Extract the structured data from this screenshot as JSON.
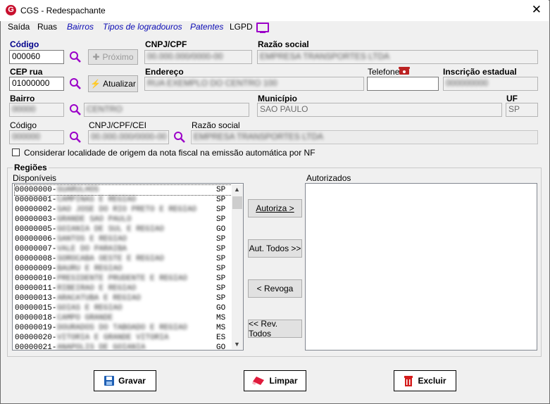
{
  "window": {
    "title": "CGS - Redespachante"
  },
  "menu": [
    "Saída",
    "Ruas",
    "Bairros",
    "Tipos de logradouros",
    "Patentes",
    "LGPD"
  ],
  "form": {
    "codigo_label": "Código",
    "codigo_value": "000060",
    "proximo_label": "Próximo",
    "cnpj_label": "CNPJ/CPF",
    "cnpj_value": "00.000.000/0000-00",
    "razao_label": "Razão social",
    "razao_value": "EMPRESA TRANSPORTES LTDA",
    "cep_label": "CEP rua",
    "cep_value": "01000000",
    "atualizar_label": "Atualizar",
    "endereco_label": "Endereço",
    "endereco_value": "RUA EXEMPLO DO CENTRO 100",
    "telefone_label": "Telefone",
    "telefone_value": "",
    "ie_label": "Inscrição estadual",
    "ie_value": "000000000",
    "bairro_label": "Bairro",
    "bairro_value": "00000",
    "bairro_desc": "CENTRO",
    "municipio_label": "Município",
    "municipio_value": "SAO PAULO",
    "uf_label": "UF",
    "uf_value": "SP",
    "codigo2_label": "Código",
    "codigo2_value": "000000",
    "cnpj2_label": "CNPJ/CPF/CEI",
    "cnpj2_value": "00.000.000/0000-00",
    "razao2_label": "Razão social",
    "razao2_value": "EMPRESA TRANSPORTES LTDA",
    "considerar_label": "Considerar localidade de origem da nota fiscal na emissão automática por NF"
  },
  "regioes": {
    "title": "Regiões",
    "disponiveis_label": "Disponíveis",
    "autorizados_label": "Autorizados",
    "items": [
      {
        "code": "00000000-",
        "name": "GUARULHOS",
        "uf": "SP"
      },
      {
        "code": "00000001-",
        "name": "CAMPINAS E REGIAO",
        "uf": "SP"
      },
      {
        "code": "00000002-",
        "name": "SAO JOSE DO RIO PRETO E REGIAO",
        "uf": "SP"
      },
      {
        "code": "00000003-",
        "name": "GRANDE SAO PAULO",
        "uf": "SP"
      },
      {
        "code": "00000005-",
        "name": "GOIANIA DE SUL E REGIAO",
        "uf": "GO"
      },
      {
        "code": "00000006-",
        "name": "SANTOS E REGIAO",
        "uf": "SP"
      },
      {
        "code": "00000007-",
        "name": "VALE DO PARAIBA",
        "uf": "SP"
      },
      {
        "code": "00000008-",
        "name": "SOROCABA OESTE E REGIAO",
        "uf": "SP"
      },
      {
        "code": "00000009-",
        "name": "BAURU E REGIAO",
        "uf": "SP"
      },
      {
        "code": "00000010-",
        "name": "PRESIDENTE PRUDENTE E REGIAO",
        "uf": "SP"
      },
      {
        "code": "00000011-",
        "name": "RIBEIRAO E REGIAO",
        "uf": "SP"
      },
      {
        "code": "00000013-",
        "name": "ARACATUBA E REGIAO",
        "uf": "SP"
      },
      {
        "code": "00000015-",
        "name": "GOIAS E REGIAO",
        "uf": "GO"
      },
      {
        "code": "00000018-",
        "name": "CAMPO GRANDE",
        "uf": "MS"
      },
      {
        "code": "00000019-",
        "name": "DOURADOS DO TABOADO E REGIAO",
        "uf": "MS"
      },
      {
        "code": "00000020-",
        "name": "VITORIA E GRANDE VITORIA",
        "uf": "ES"
      },
      {
        "code": "00000021-",
        "name": "ANAPOLIS DE GOIANIA",
        "uf": "GO"
      }
    ],
    "autoriza_label": "Autoriza >",
    "aut_todos_label": "Aut. Todos >>",
    "revoga_label": "< Revoga",
    "rev_todos_label": "<< Rev. Todos"
  },
  "actions": {
    "gravar": "Gravar",
    "limpar": "Limpar",
    "excluir": "Excluir"
  },
  "colors": {
    "accent": "#c8102e",
    "link": "#0a0ab4",
    "lookup": "#9b00c8"
  }
}
